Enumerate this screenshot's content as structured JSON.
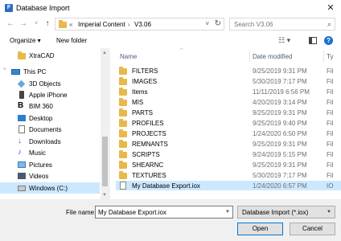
{
  "window": {
    "title": "Database Import",
    "app_icon_letter": "F",
    "close_glyph": "✕"
  },
  "address_bar": {
    "breadcrumbs": [
      "Imperial Content",
      "V3.06"
    ],
    "overflow_glyph": "«",
    "separator_glyph": "›",
    "search_placeholder": "Search V3.06"
  },
  "toolbar": {
    "organize_label": "Organize ▾",
    "new_folder_label": "New folder"
  },
  "nav_pane": {
    "items": [
      {
        "label": "XtraCAD",
        "icon": "folder-icon"
      },
      {
        "label": "This PC",
        "icon": "computer-icon"
      },
      {
        "label": "3D Objects",
        "icon": "3d-objects-icon"
      },
      {
        "label": "Apple iPhone",
        "icon": "phone-icon"
      },
      {
        "label": "BIM 360",
        "icon": "bim360-icon"
      },
      {
        "label": "Desktop",
        "icon": "desktop-icon"
      },
      {
        "label": "Documents",
        "icon": "documents-icon"
      },
      {
        "label": "Downloads",
        "icon": "downloads-icon"
      },
      {
        "label": "Music",
        "icon": "music-icon"
      },
      {
        "label": "Pictures",
        "icon": "pictures-icon"
      },
      {
        "label": "Videos",
        "icon": "videos-icon"
      },
      {
        "label": "Windows (C:)",
        "icon": "drive-icon"
      }
    ]
  },
  "file_list": {
    "columns": {
      "name": "Name",
      "date": "Date modified",
      "type": "Ty"
    },
    "rows": [
      {
        "name": "FILTERS",
        "date": "9/25/2019 9:31 PM",
        "type": "Fil"
      },
      {
        "name": "IMAGES",
        "date": "5/30/2019 7:17 PM",
        "type": "Fil"
      },
      {
        "name": "Items",
        "date": "11/11/2019 6:56 PM",
        "type": "Fil"
      },
      {
        "name": "MIS",
        "date": "4/20/2019 3:14 PM",
        "type": "Fil"
      },
      {
        "name": "PARTS",
        "date": "9/25/2019 9:31 PM",
        "type": "Fil"
      },
      {
        "name": "PROFILES",
        "date": "9/25/2019 9:40 PM",
        "type": "Fil"
      },
      {
        "name": "PROJECTS",
        "date": "1/24/2020 6:50 PM",
        "type": "Fil"
      },
      {
        "name": "REMNANTS",
        "date": "9/25/2019 9:31 PM",
        "type": "Fil"
      },
      {
        "name": "SCRIPTS",
        "date": "9/24/2019 5:15 PM",
        "type": "Fil"
      },
      {
        "name": "SHEARNC",
        "date": "9/25/2019 9:31 PM",
        "type": "Fil"
      },
      {
        "name": "TEXTURES",
        "date": "5/30/2019 7:17 PM",
        "type": "Fil"
      },
      {
        "name": "My Database Export.iox",
        "date": "1/24/2020 6:57 PM",
        "type": "IO"
      }
    ]
  },
  "footer": {
    "file_name_label": "File name:",
    "file_name_value": "My Database Export.iox",
    "file_type_value": "Database Import (*.iox)",
    "open_label": "Open",
    "cancel_label": "Cancel"
  }
}
